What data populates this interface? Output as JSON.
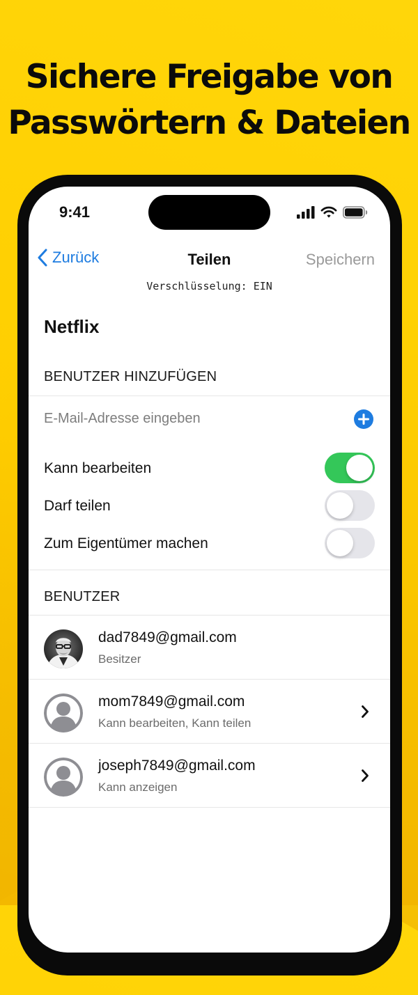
{
  "headline": {
    "line1": "Sichere Freigabe von",
    "line2": "Passwörtern & Dateien"
  },
  "status_bar": {
    "time": "9:41",
    "icons": [
      "cellular-signal-icon",
      "wifi-icon",
      "battery-icon"
    ]
  },
  "nav": {
    "back_label": "Zurück",
    "title": "Teilen",
    "save_label": "Speichern"
  },
  "encryption_status": "Verschlüsselung: EIN",
  "item_title": "Netflix",
  "add_users": {
    "header": "BENUTZER HINZUFÜGEN",
    "email_placeholder": "E-Mail-Adresse eingeben",
    "email_value": "",
    "add_icon": "plus-circle-icon",
    "options": [
      {
        "label": "Kann bearbeiten",
        "enabled": true
      },
      {
        "label": "Darf teilen",
        "enabled": false
      },
      {
        "label": "Zum Eigentümer machen",
        "enabled": false
      }
    ]
  },
  "users": {
    "header": "BENUTZER",
    "list": [
      {
        "email": "dad7849@gmail.com",
        "role": "Besitzer",
        "avatar": "photo",
        "has_chevron": false
      },
      {
        "email": "mom7849@gmail.com",
        "role": "Kann bearbeiten, Kann teilen",
        "avatar": "placeholder-person-icon",
        "has_chevron": true
      },
      {
        "email": "joseph7849@gmail.com",
        "role": "Kann anzeigen",
        "avatar": "placeholder-person-icon",
        "has_chevron": true
      }
    ]
  },
  "colors": {
    "background": "#FFD00A",
    "accent_blue": "#1E7CE0",
    "toggle_on": "#34C759",
    "toggle_off": "#E5E5EA",
    "disabled_text": "#9A9A9A"
  }
}
